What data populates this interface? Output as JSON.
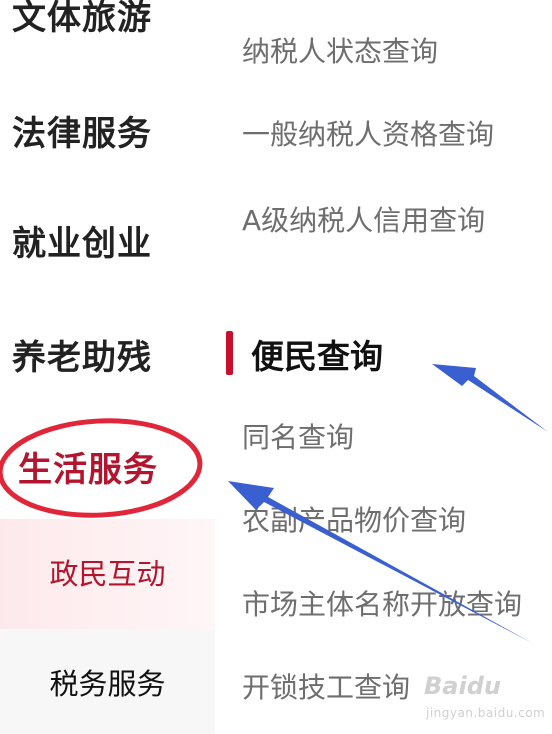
{
  "categories": [
    {
      "label": "文体旅游"
    },
    {
      "label": "法律服务"
    },
    {
      "label": "就业创业"
    },
    {
      "label": "养老助残"
    },
    {
      "label": "生活服务"
    },
    {
      "label": "政民互动"
    },
    {
      "label": "税务服务"
    }
  ],
  "items_top": [
    {
      "label": "纳税人状态查询"
    },
    {
      "label": "一般纳税人资格查询"
    },
    {
      "label": "A级纳税人信用查询"
    }
  ],
  "section": {
    "title": "便民查询"
  },
  "items_section": [
    {
      "label": "同名查询"
    },
    {
      "label": "农副产品物价查询"
    },
    {
      "label": "市场主体名称开放查询"
    },
    {
      "label": "开锁技工查询"
    }
  ],
  "watermark": {
    "brand": "Baidu",
    "sub": "jingyan.baidu.com"
  },
  "colors": {
    "accent": "#c8102e",
    "annotation_circle": "#e2263a",
    "annotation_arrow": "#3a5fd0"
  }
}
